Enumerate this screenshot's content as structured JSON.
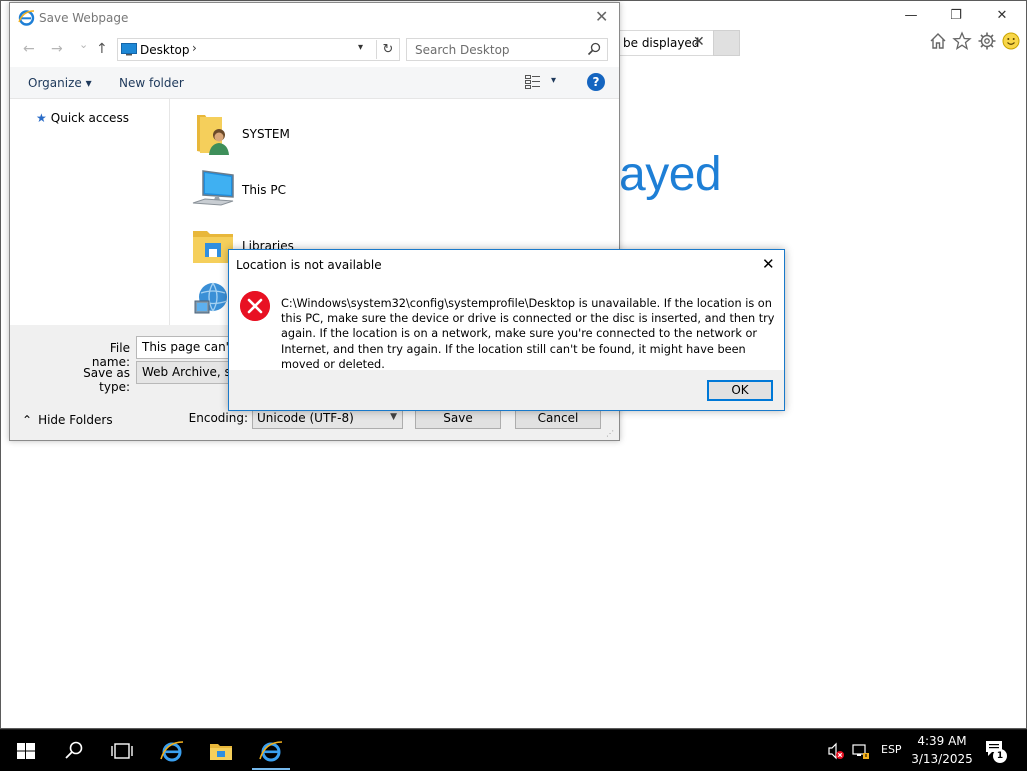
{
  "ie": {
    "tab_title": "be displayed",
    "tab_close": "✕",
    "big_text": "ayed",
    "window_controls": {
      "minimize": "—",
      "restore": "❐",
      "close": "✕"
    },
    "toolbar_icons": [
      "home-icon",
      "star-icon",
      "gear-icon",
      "smiley-icon"
    ]
  },
  "save_dialog": {
    "title": "Save Webpage",
    "close": "✕",
    "nav": {
      "back": "←",
      "forward": "→",
      "recent": "⌄",
      "up": "↑"
    },
    "address": {
      "location": "Desktop",
      "chevron": "›",
      "dropdown": "▾",
      "refresh": "↻"
    },
    "search": {
      "placeholder": "Search Desktop"
    },
    "toolbar": {
      "organize": "Organize ▾",
      "new_folder": "New folder",
      "view_dropdown": "▾",
      "help": "?"
    },
    "nav_pane": {
      "quick_access": "Quick access"
    },
    "items": [
      {
        "label": "SYSTEM",
        "icon": "user-folder-icon"
      },
      {
        "label": "This PC",
        "icon": "computer-icon"
      },
      {
        "label": "Libraries",
        "icon": "libraries-icon"
      },
      {
        "label": "",
        "icon": "network-icon"
      }
    ],
    "file_name": {
      "label": "File name:",
      "value": "This page can't b"
    },
    "save_as_type": {
      "label": "Save as type:",
      "value": "Web Archive, sin"
    },
    "hide_folders": "Hide Folders",
    "encoding": {
      "label": "Encoding:",
      "value": "Unicode (UTF-8)"
    },
    "save_label": "Save",
    "cancel_label": "Cancel"
  },
  "error_dialog": {
    "title": "Location is not available",
    "close": "✕",
    "message": "C:\\Windows\\system32\\config\\systemprofile\\Desktop is unavailable. If the location is on this PC, make sure the device or drive is connected or the disc is inserted, and then try again. If the location is on a network, make sure you're connected to the network or Internet, and then try again. If the location still can't be found, it might have been moved or deleted.",
    "ok_label": "OK"
  },
  "taskbar": {
    "language": "ESP",
    "time": "4:39 AM",
    "date": "3/13/2025",
    "notification_count": "1",
    "icons": [
      "start-icon",
      "search-icon",
      "task-view-icon",
      "internet-explorer-icon",
      "file-explorer-icon",
      "internet-explorer-active-icon"
    ]
  },
  "colors": {
    "accent": "#0078d7",
    "error_red": "#e81123",
    "ie_blue": "#1e7fd6"
  }
}
